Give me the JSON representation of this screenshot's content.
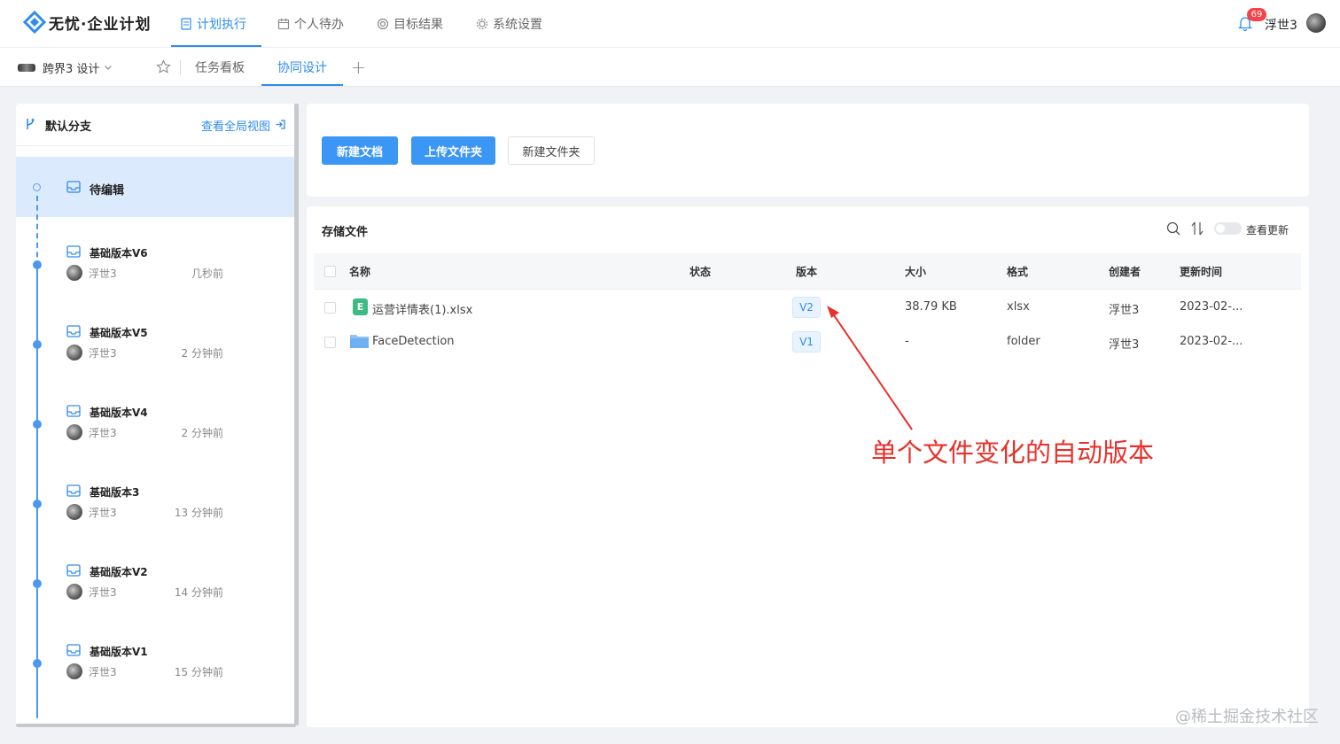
{
  "app": {
    "logo_text": "无忧·企业计划",
    "brand_color": "#2e8cf0"
  },
  "nav": {
    "items": [
      {
        "label": "计划执行",
        "icon": "document-icon",
        "active": true
      },
      {
        "label": "个人待办",
        "icon": "calendar-icon",
        "active": false
      },
      {
        "label": "目标结果",
        "icon": "target-icon",
        "active": false
      },
      {
        "label": "系统设置",
        "icon": "gear-icon",
        "active": false
      }
    ],
    "notification_count": "69",
    "user_name": "浮世3"
  },
  "subbar": {
    "project_name": "跨界3 设计",
    "tabs": [
      {
        "label": "任务看板",
        "active": false
      },
      {
        "label": "协同设计",
        "active": true
      }
    ],
    "add_label": "+"
  },
  "branch_panel": {
    "branch_name": "默认分支",
    "global_view_link": "查看全局视图",
    "pending_label": "待编辑",
    "versions": [
      {
        "name": "基础版本V6",
        "user": "浮世3",
        "time": "几秒前"
      },
      {
        "name": "基础版本V5",
        "user": "浮世3",
        "time": "2 分钟前"
      },
      {
        "name": "基础版本V4",
        "user": "浮世3",
        "time": "2 分钟前"
      },
      {
        "name": "基础版本3",
        "user": "浮世3",
        "time": "13 分钟前"
      },
      {
        "name": "基础版本V2",
        "user": "浮世3",
        "time": "14 分钟前"
      },
      {
        "name": "基础版本V1",
        "user": "浮世3",
        "time": "15 分钟前"
      }
    ]
  },
  "actions": {
    "new_doc": "新建文档",
    "upload_folder": "上传文件夹",
    "new_folder": "新建文件夹"
  },
  "files": {
    "title": "存储文件",
    "toggle_label": "查看更新",
    "columns": [
      "名称",
      "状态",
      "版本",
      "大小",
      "格式",
      "创建者",
      "更新时间"
    ],
    "rows": [
      {
        "name": "运营详情表(1).xlsx",
        "icon": "excel-file-icon",
        "icon_letter": "E",
        "status": "",
        "version": "V2",
        "size": "38.79 KB",
        "format": "xlsx",
        "creator": "浮世3",
        "updated": "2023-02-..."
      },
      {
        "name": "FaceDetection",
        "icon": "folder-icon",
        "status": "",
        "version": "V1",
        "size": "-",
        "format": "folder",
        "creator": "浮世3",
        "updated": "2023-02-..."
      }
    ]
  },
  "annotation": {
    "text": "单个文件变化的自动版本",
    "color": "#e8312b"
  },
  "watermark": "@稀土掘金技术社区"
}
